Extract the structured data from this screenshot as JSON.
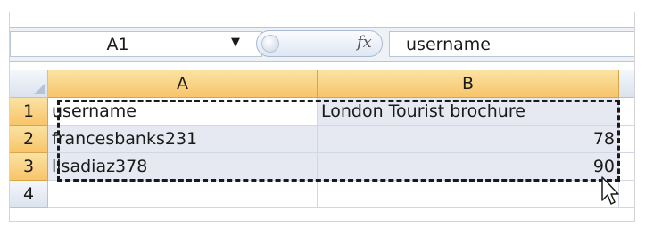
{
  "formula_bar": {
    "name_box": "A1",
    "fx_symbol": "fx",
    "formula_value": "username"
  },
  "sheet": {
    "columns": [
      "A",
      "B"
    ],
    "rows": [
      {
        "number": "1",
        "a": "username",
        "b": "London Tourist brochure"
      },
      {
        "number": "2",
        "a": "francesbanks231",
        "b": "78"
      },
      {
        "number": "3",
        "a": "lisadiaz378",
        "b": "90"
      },
      {
        "number": "4",
        "a": "",
        "b": ""
      }
    ]
  },
  "colors": {
    "selected_header": "#f7c56a",
    "selection_fill": "#e6e9f1",
    "gridline": "#d0d7e5"
  },
  "icons": {
    "name_box_dropdown": "dropdown-arrow-icon",
    "function": "fx-icon",
    "cursor": "mouse-pointer-icon"
  }
}
